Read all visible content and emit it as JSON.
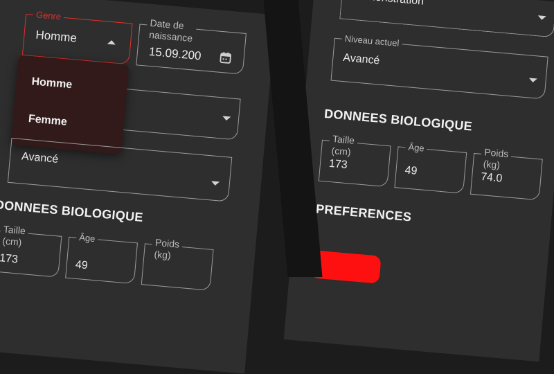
{
  "left": {
    "genre": {
      "label": "Genre",
      "value": "Homme"
    },
    "birthdate": {
      "label_line1": "Date de",
      "label_line2": "naissance",
      "value": "15.09.200"
    },
    "menu": {
      "options": [
        "Homme",
        "Femme"
      ]
    },
    "level": {
      "value": "Avancé"
    },
    "bio": {
      "title": "DONNEES BIOLOGIQUE",
      "height": {
        "label_line1": "Taille",
        "label_line2": "(cm)",
        "value": "173"
      },
      "age": {
        "label": "Âge",
        "value": "49"
      },
      "weight": {
        "label_line1": "Poids",
        "label_line2": "(kg)"
      }
    }
  },
  "right": {
    "goal": {
      "value": "Démonstration"
    },
    "level": {
      "label": "Niveau actuel",
      "value": "Avancé"
    },
    "bio": {
      "title": "DONNEES BIOLOGIQUE",
      "height": {
        "label_line1": "Taille",
        "label_line2": "(cm)",
        "value": "173"
      },
      "age": {
        "label": "Âge",
        "value": "49"
      },
      "weight": {
        "label_line1": "Poids",
        "label_line2": "(kg)",
        "value": "74.0"
      }
    },
    "preferences": {
      "title": "PREFERENCES"
    }
  },
  "colors": {
    "accent": "#e0312f",
    "background": "#2e2e2e",
    "menu": "#321a1b",
    "button": "#ff1010"
  }
}
